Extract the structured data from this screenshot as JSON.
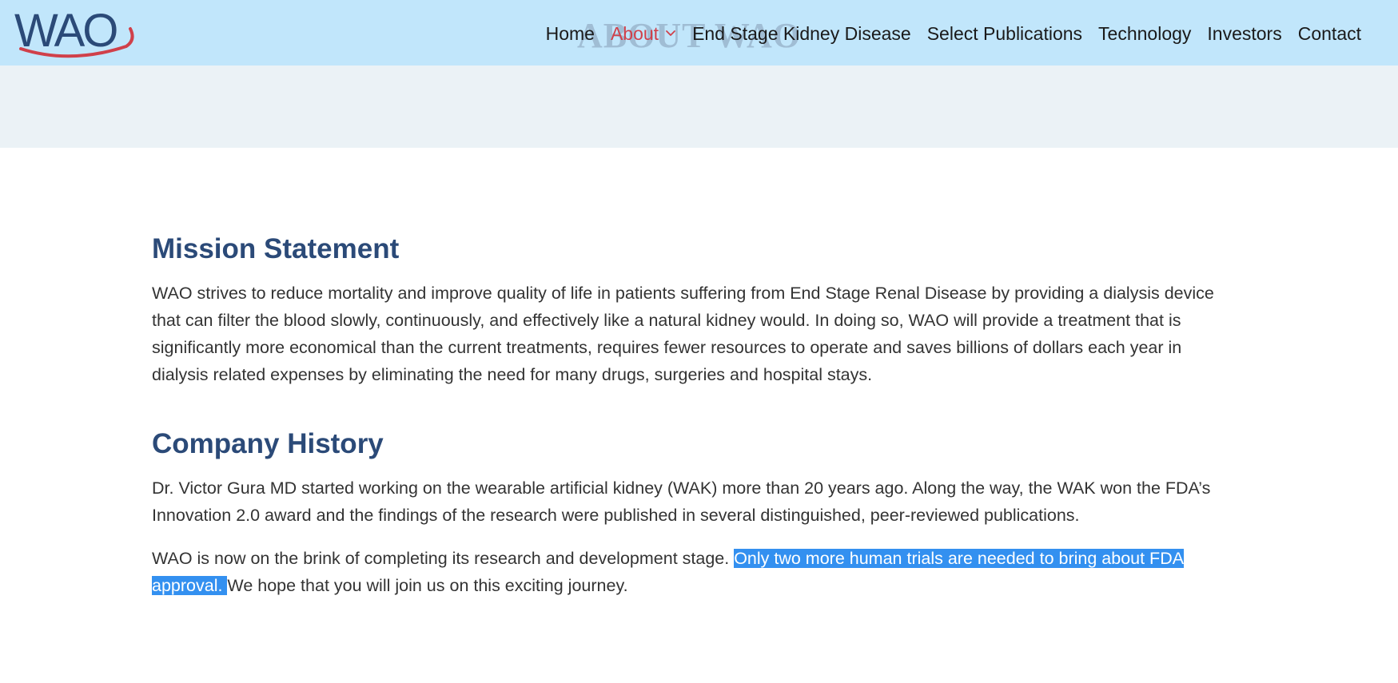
{
  "header": {
    "logo_text": "WAO",
    "ghost_title": "ABOUT WAO",
    "nav": [
      {
        "label": "Home"
      },
      {
        "label": "About"
      },
      {
        "label": "End Stage Kidney Disease"
      },
      {
        "label": "Select Publications"
      },
      {
        "label": "Technology"
      },
      {
        "label": "Investors"
      },
      {
        "label": "Contact"
      }
    ]
  },
  "colors": {
    "header_bg": "#c1e6fb",
    "subband_bg": "#ebf2f6",
    "heading": "#2b4a78",
    "active_nav": "#d0404a",
    "selection": "#3390f0"
  },
  "mission": {
    "heading": "Mission Statement",
    "text": "WAO strives to reduce mortality and improve quality of life in patients suffering from End Stage Renal Disease by providing a dialysis device that can filter the blood slowly, continuously, and effectively like a natural kidney would. In doing so, WAO will provide a treatment that is significantly more economical than the current treatments, requires fewer resources to operate and saves billions of dollars each year in dialysis related expenses by eliminating the need for many drugs, surgeries and hospital stays."
  },
  "history": {
    "heading": "Company History",
    "para1": "Dr. Victor Gura MD started working on the wearable artificial kidney (WAK) more than 20 years ago. Along the way, the WAK won the FDA’s Innovation 2.0 award and the findings of the research were published in several distinguished, peer-reviewed publications.",
    "para2_before": "WAO is now on the brink of completing its research and development stage. ",
    "para2_selected": "Only two more human trials are needed to bring about FDA approval. ",
    "para2_after": "We hope that you will join us on this exciting journey."
  }
}
